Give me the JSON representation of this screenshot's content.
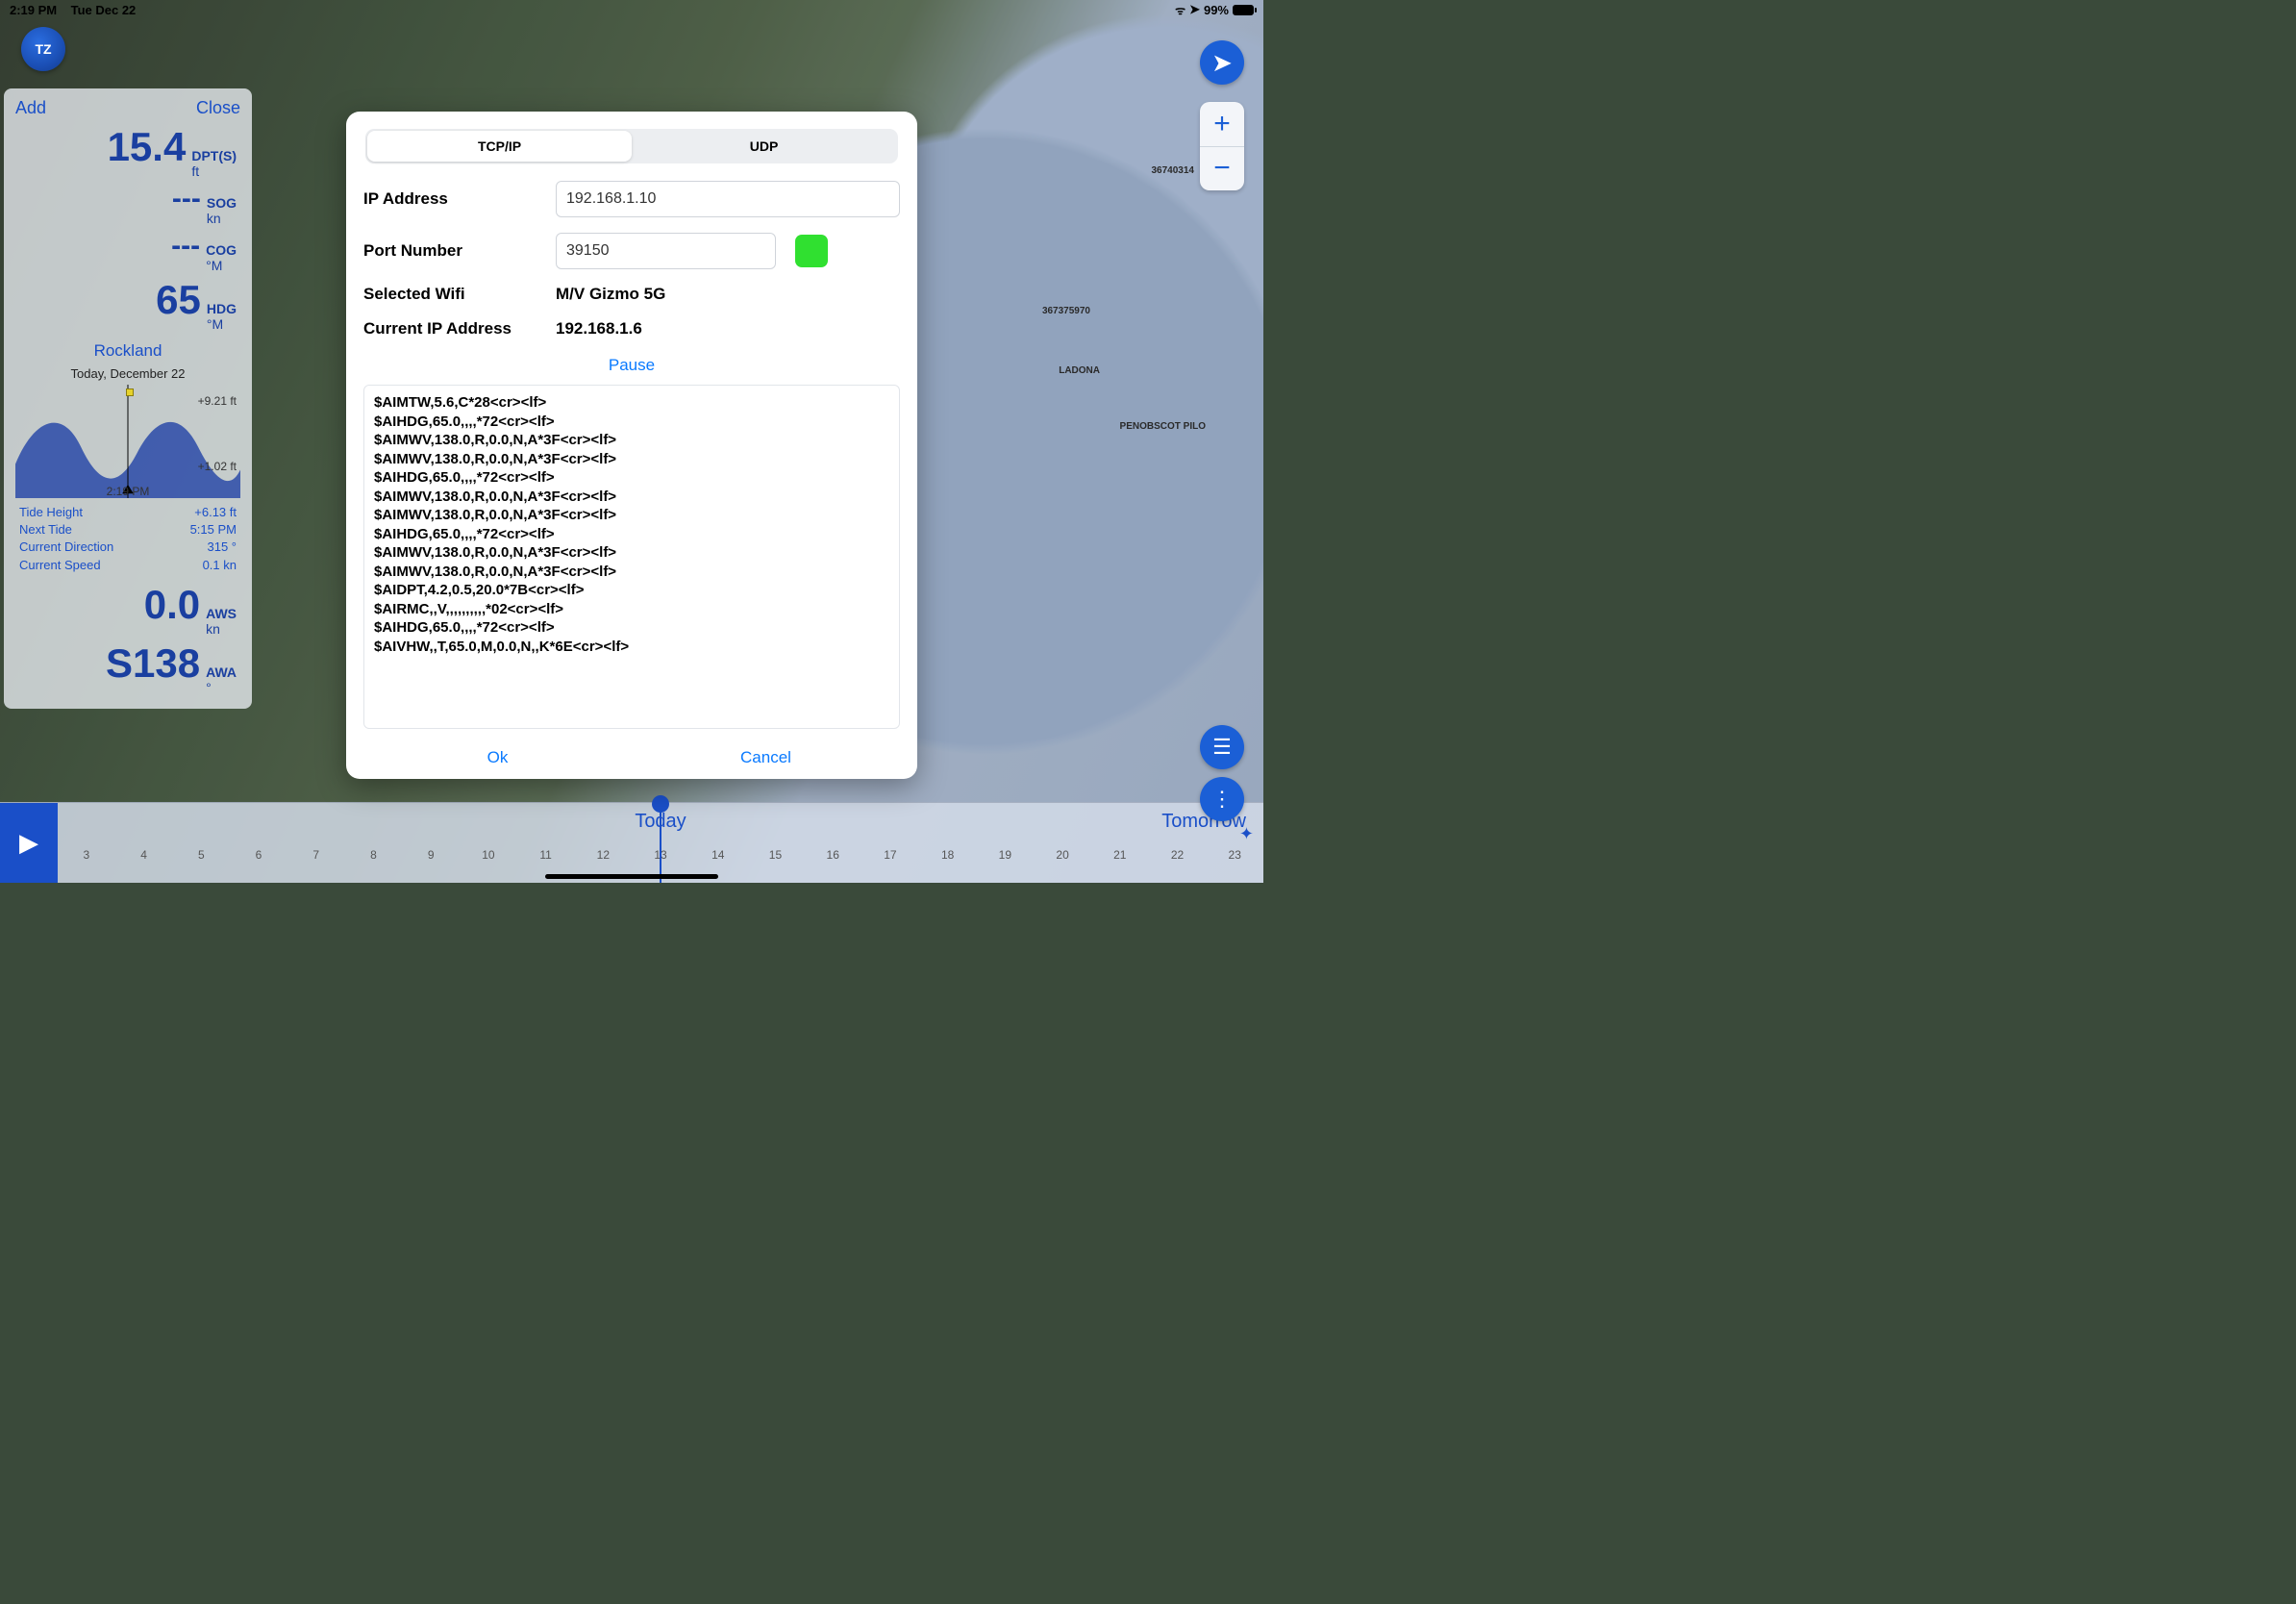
{
  "statusbar": {
    "time": "2:19 PM",
    "date": "Tue Dec 22",
    "battery": "99%"
  },
  "app_logo": "TZ",
  "nav_panel": {
    "add_label": "Add",
    "close_label": "Close",
    "dpt": {
      "value": "15.4",
      "label": "DPT(S)",
      "unit": "ft"
    },
    "sog": {
      "value": "---",
      "label": "SOG",
      "unit": "kn"
    },
    "cog": {
      "value": "---",
      "label": "COG",
      "unit": "°M"
    },
    "hdg": {
      "value": "65",
      "label": "HDG",
      "unit": "°M"
    },
    "place": "Rockland",
    "date_label": "Today, December 22",
    "tide_high": "+9.21 ft",
    "tide_low": "+1.02 ft",
    "tide_time": "2:19 PM",
    "rows": [
      {
        "k": "Tide Height",
        "v": "+6.13 ft"
      },
      {
        "k": "Next Tide",
        "v": "5:15 PM"
      },
      {
        "k": "Current Direction",
        "v": "315 °"
      },
      {
        "k": "Current Speed",
        "v": "0.1 kn"
      }
    ],
    "aws": {
      "value": "0.0",
      "label": "AWS",
      "unit": "kn"
    },
    "awa": {
      "value": "S138",
      "label": "AWA",
      "unit": "°"
    }
  },
  "modal": {
    "tab_tcpip": "TCP/IP",
    "tab_udp": "UDP",
    "ip_label": "IP Address",
    "ip_value": "192.168.1.10",
    "port_label": "Port Number",
    "port_value": "39150",
    "wifi_label": "Selected Wifi",
    "wifi_value": "M/V Gizmo 5G",
    "curip_label": "Current IP Address",
    "curip_value": "192.168.1.6",
    "pause_label": "Pause",
    "log_lines": "$AIMTW,5.6,C*28<cr><lf>\n$AIHDG,65.0,,,,*72<cr><lf>\n$AIMWV,138.0,R,0.0,N,A*3F<cr><lf>\n$AIMWV,138.0,R,0.0,N,A*3F<cr><lf>\n$AIHDG,65.0,,,,*72<cr><lf>\n$AIMWV,138.0,R,0.0,N,A*3F<cr><lf>\n$AIMWV,138.0,R,0.0,N,A*3F<cr><lf>\n$AIHDG,65.0,,,,*72<cr><lf>\n$AIMWV,138.0,R,0.0,N,A*3F<cr><lf>\n$AIMWV,138.0,R,0.0,N,A*3F<cr><lf>\n$AIDPT,4.2,0.5,20.0*7B<cr><lf>\n$AIRMC,,V,,,,,,,,,,*02<cr><lf>\n$AIHDG,65.0,,,,*72<cr><lf>\n$AIVHW,,T,65.0,M,0.0,N,,K*6E<cr><lf>",
    "ok_label": "Ok",
    "cancel_label": "Cancel"
  },
  "timeline": {
    "today_label": "Today",
    "tomorrow_label": "Tomorrow",
    "hours": [
      "3",
      "4",
      "5",
      "6",
      "7",
      "8",
      "9",
      "10",
      "11",
      "12",
      "13",
      "14",
      "15",
      "16",
      "17",
      "18",
      "19",
      "20",
      "21",
      "22",
      "23"
    ]
  },
  "map_labels": {
    "a": "36740314",
    "b": "367375970",
    "c": "LADONA",
    "d": "PENOBSCOT PILO"
  }
}
